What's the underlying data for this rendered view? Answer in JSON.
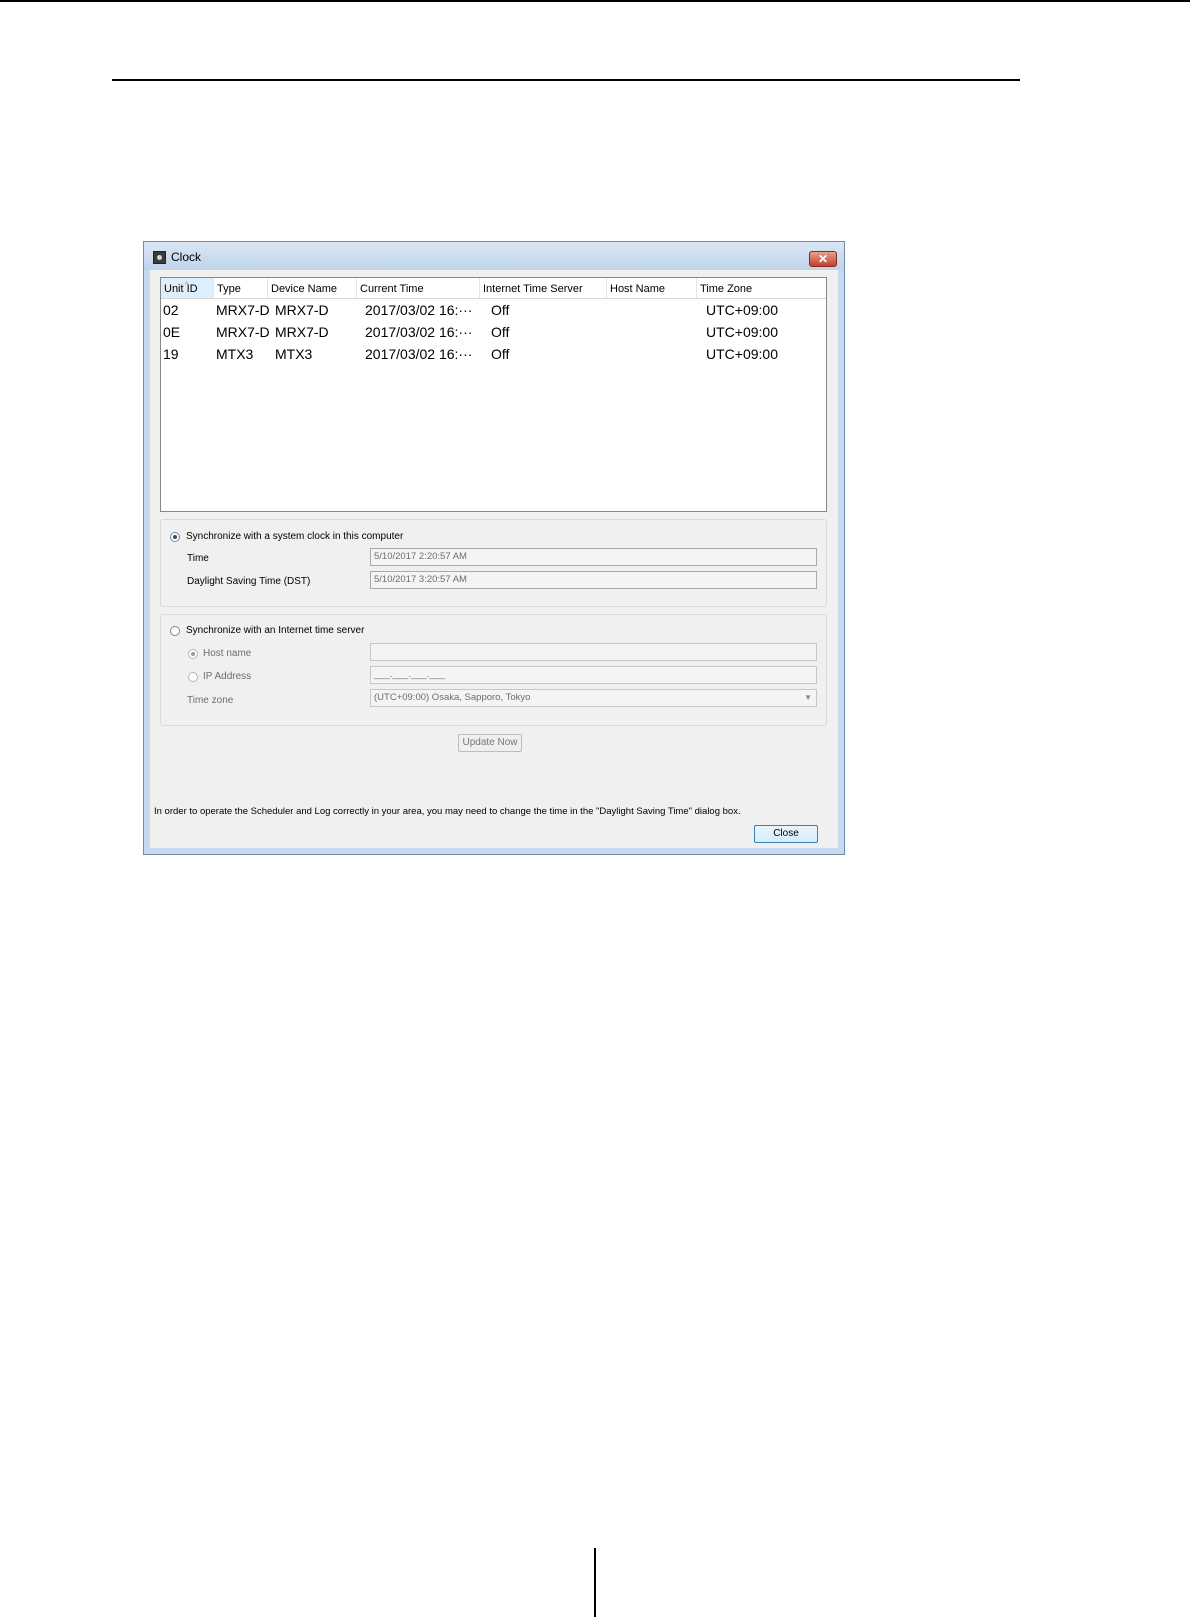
{
  "dialog": {
    "title": "Clock",
    "close_glyph": "✕",
    "app_icon": "clock-app-icon"
  },
  "table": {
    "columns": [
      "Unit ID",
      "Type",
      "Device Name",
      "Current Time",
      "Internet Time Server",
      "Host Name",
      "Time Zone"
    ],
    "sort_indicator": "^",
    "rows": [
      [
        "02",
        "MRX7-D",
        "MRX7-D",
        "2017/03/02 16:···",
        "Off",
        "",
        "UTC+09:00"
      ],
      [
        "0E",
        "MRX7-D",
        "MRX7-D",
        "2017/03/02 16:···",
        "Off",
        "",
        "UTC+09:00"
      ],
      [
        "19",
        "MTX3",
        "MTX3",
        "2017/03/02 16:···",
        "Off",
        "",
        "UTC+09:00"
      ]
    ]
  },
  "system_clock": {
    "radio_label": "Synchronize with a system clock in this computer",
    "selected": true,
    "time_label": "Time",
    "time_value": "5/10/2017 2:20:57 AM",
    "dst_label": "Daylight Saving Time (DST)",
    "dst_value": "5/10/2017 3:20:57 AM"
  },
  "internet_server": {
    "radio_label": "Synchronize with an Internet time server",
    "selected": false,
    "host_label": "Host name",
    "host_value": "",
    "ip_label": "IP Address",
    "ip_value": "___.___.___.___",
    "timezone_label": "Time zone",
    "timezone_value": "(UTC+09:00) Osaka, Sapporo, Tokyo"
  },
  "buttons": {
    "update_now": "Update Now",
    "close": "Close"
  },
  "note": "In order to operate the Scheduler and Log correctly in your area, you may need to change the time in the \"Daylight Saving Time\" dialog box."
}
